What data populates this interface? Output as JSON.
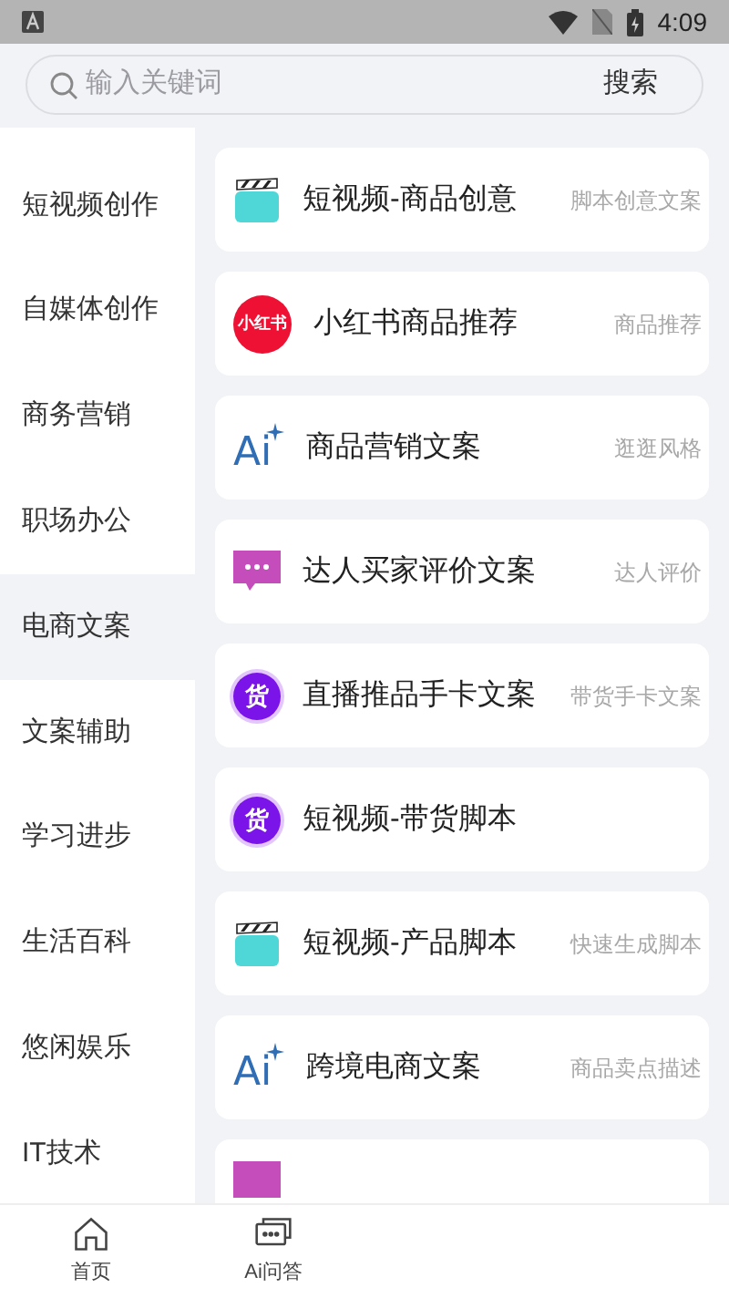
{
  "status_bar": {
    "time": "4:09"
  },
  "search": {
    "placeholder": "输入关键词",
    "button": "搜索"
  },
  "sidebar": {
    "items": [
      {
        "label": "短视频创作",
        "selected": false
      },
      {
        "label": "自媒体创作",
        "selected": false
      },
      {
        "label": "商务营销",
        "selected": false
      },
      {
        "label": "职场办公",
        "selected": false
      },
      {
        "label": "电商文案",
        "selected": true
      },
      {
        "label": "文案辅助",
        "selected": false
      },
      {
        "label": "学习进步",
        "selected": false
      },
      {
        "label": "生活百科",
        "selected": false
      },
      {
        "label": "悠闲娱乐",
        "selected": false
      },
      {
        "label": "IT技术",
        "selected": false
      }
    ]
  },
  "cards": [
    {
      "icon": {
        "kind": "clapper"
      },
      "title": "短视频-商品创意",
      "tag": "脚本创意文案"
    },
    {
      "icon": {
        "kind": "badge",
        "logo_text": "小红书"
      },
      "title": "小红书商品推荐",
      "tag": "商品推荐"
    },
    {
      "icon": {
        "kind": "ai",
        "logo_text": "Ai"
      },
      "title": "商品营销文案",
      "tag": "逛逛风格"
    },
    {
      "icon": {
        "kind": "chat"
      },
      "title": "达人买家评价文案",
      "tag": "达人评价"
    },
    {
      "icon": {
        "kind": "goods",
        "logo_text": "货"
      },
      "title": "直播推品手卡文案",
      "tag": "带货手卡文案"
    },
    {
      "icon": {
        "kind": "goods",
        "logo_text": "货"
      },
      "title": "短视频-带货脚本"
    },
    {
      "icon": {
        "kind": "clapper"
      },
      "title": "短视频-产品脚本",
      "tag": "快速生成脚本"
    },
    {
      "icon": {
        "kind": "ai",
        "logo_text": "Ai"
      },
      "title": "跨境电商文案",
      "tag": "商品卖点描述"
    },
    {
      "icon": {
        "kind": "block"
      }
    }
  ],
  "bottom_nav": [
    {
      "label": "首页",
      "kind": "home"
    },
    {
      "label": "Ai问答",
      "kind": "chat"
    }
  ]
}
